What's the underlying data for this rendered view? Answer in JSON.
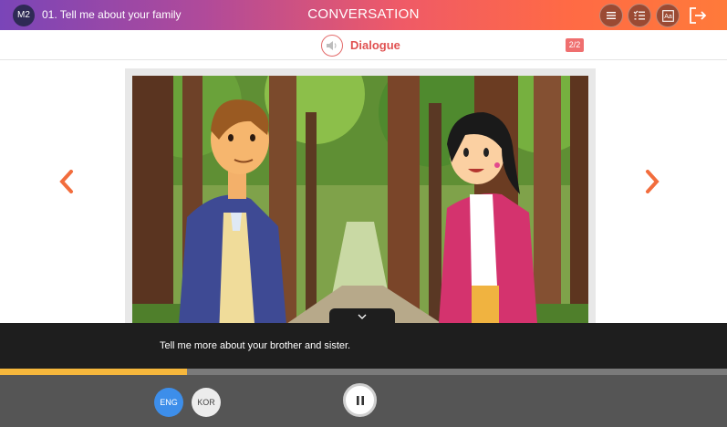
{
  "header": {
    "module_badge": "M2",
    "lesson_title": "01. Tell me about your family",
    "app_title": "CONVERSATION",
    "tools": [
      {
        "icon": "menu-icon"
      },
      {
        "icon": "checklist-icon"
      },
      {
        "icon": "font-size-icon"
      }
    ],
    "exit_icon": "exit-icon"
  },
  "subheader": {
    "speaker_icon": "speaker-icon",
    "title": "Dialogue",
    "page": "2/2"
  },
  "stage": {
    "scene": "forest-path",
    "characters": [
      "boy-in-blue-blazer",
      "girl-in-pink-blazer"
    ]
  },
  "caption": {
    "text": "Tell me more about your brother and sister."
  },
  "progress": {
    "value": 0.257
  },
  "controls": {
    "lang_eng": "ENG",
    "lang_kor": "KOR",
    "active_lang": "ENG",
    "pause_icon": "pause-icon"
  },
  "colors": {
    "accent_orange": "#f26d3d",
    "header_start": "#7a45b8",
    "header_end": "#ff7a3a",
    "dialogue_red": "#e05252",
    "progress": "#f6b73c",
    "eng_active": "#3d8eea"
  }
}
